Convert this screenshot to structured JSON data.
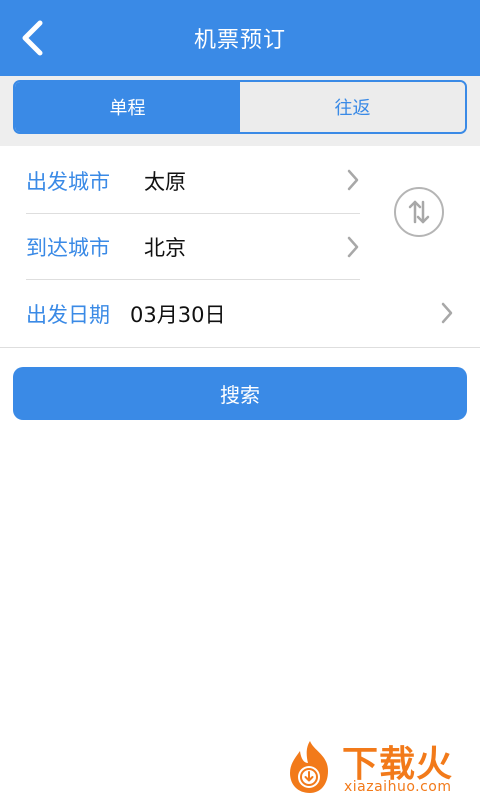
{
  "header": {
    "title": "机票预订",
    "back_icon": "chevron-left-icon"
  },
  "tabs": [
    {
      "label": "单程",
      "active": true
    },
    {
      "label": "往返",
      "active": false
    }
  ],
  "form": {
    "departure_city": {
      "label": "出发城市",
      "value": "太原"
    },
    "arrival_city": {
      "label": "到达城市",
      "value": "北京"
    },
    "departure_date": {
      "label": "出发日期",
      "value": "03月30日"
    }
  },
  "swap_icon": "swap-vertical-icon",
  "search_label": "搜索",
  "watermark": {
    "brand_cn": "下载火",
    "brand_en": "xiazaihuo.com"
  },
  "colors": {
    "primary": "#3a8ae6",
    "divider": "#dedede",
    "watermark": "#f27a1a"
  }
}
